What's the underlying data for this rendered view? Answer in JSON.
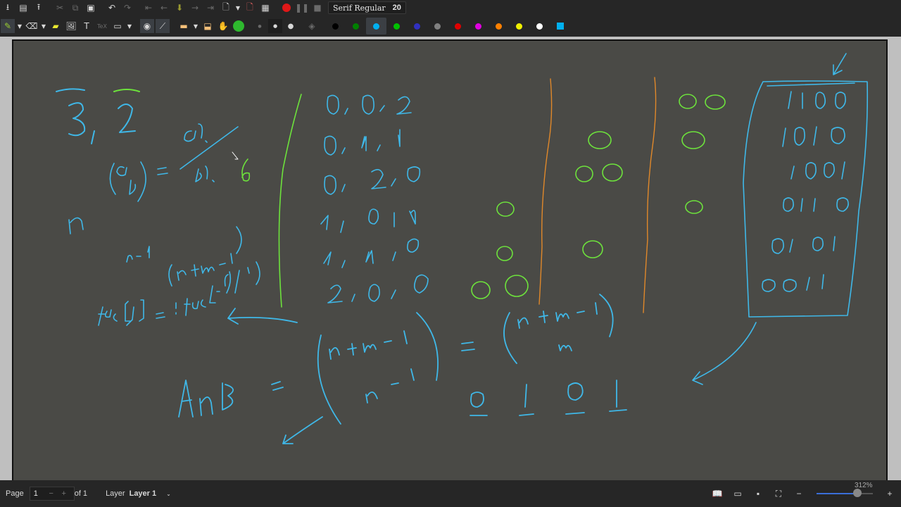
{
  "toolbar": {
    "font_name": "Serif Regular",
    "font_size": "20",
    "pen_colors": [
      {
        "name": "black",
        "hex": "#000000"
      },
      {
        "name": "green",
        "hex": "#008000"
      },
      {
        "name": "cyan",
        "hex": "#00b0f0",
        "active": true
      },
      {
        "name": "light-green",
        "hex": "#00c000"
      },
      {
        "name": "blue",
        "hex": "#3030c0"
      },
      {
        "name": "gray",
        "hex": "#808080"
      },
      {
        "name": "red",
        "hex": "#e00000"
      },
      {
        "name": "magenta",
        "hex": "#e000e0"
      },
      {
        "name": "orange",
        "hex": "#ff8000"
      },
      {
        "name": "yellow",
        "hex": "#f0f000"
      },
      {
        "name": "white",
        "hex": "#ffffff"
      }
    ]
  },
  "status": {
    "page_label": "Page",
    "page_value": "1",
    "page_total": "of 1",
    "layer_label": "Layer",
    "layer_value": "Layer 1",
    "zoom": "312%",
    "zoom_level": 0.72
  },
  "ink_colors": {
    "cyan": "#3fb8e8",
    "green": "#6de23c",
    "orange": "#e0882a"
  }
}
